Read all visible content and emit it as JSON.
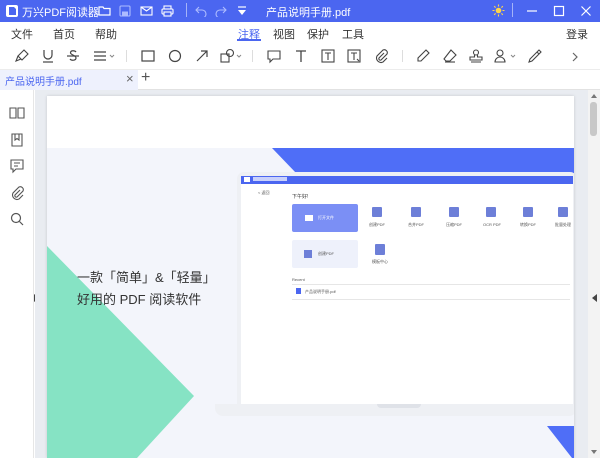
{
  "app": {
    "title": "万兴PDF阅读器",
    "document_title": "产品说明手册.pdf"
  },
  "menu": {
    "items": [
      "文件",
      "首页",
      "帮助"
    ],
    "tabs": [
      "注释",
      "视图",
      "保护",
      "工具"
    ],
    "active_tab": "注释",
    "login": "登录"
  },
  "tab": {
    "label": "产品说明手册.pdf",
    "close": "×",
    "add": "+"
  },
  "page": {
    "headline": "一款「简单」&「轻量」",
    "subline": "好用的 PDF 阅读软件"
  },
  "mock": {
    "greeting": "下午好!",
    "open_file": "打开文件",
    "actions": [
      "创建PDF",
      "合并PDF",
      "压缩PDF",
      "OCR PDF",
      "转换PDF",
      "批量处理"
    ],
    "create_pdf": "创建PDF",
    "template": "模板中心",
    "recent": "Recent",
    "recent_file": "产品说明手册.pdf",
    "back": "< 返回"
  },
  "colors": {
    "brand": "#4b66f0",
    "accent_green": "#86e3c4",
    "accent_blue": "#4f6ef7"
  }
}
